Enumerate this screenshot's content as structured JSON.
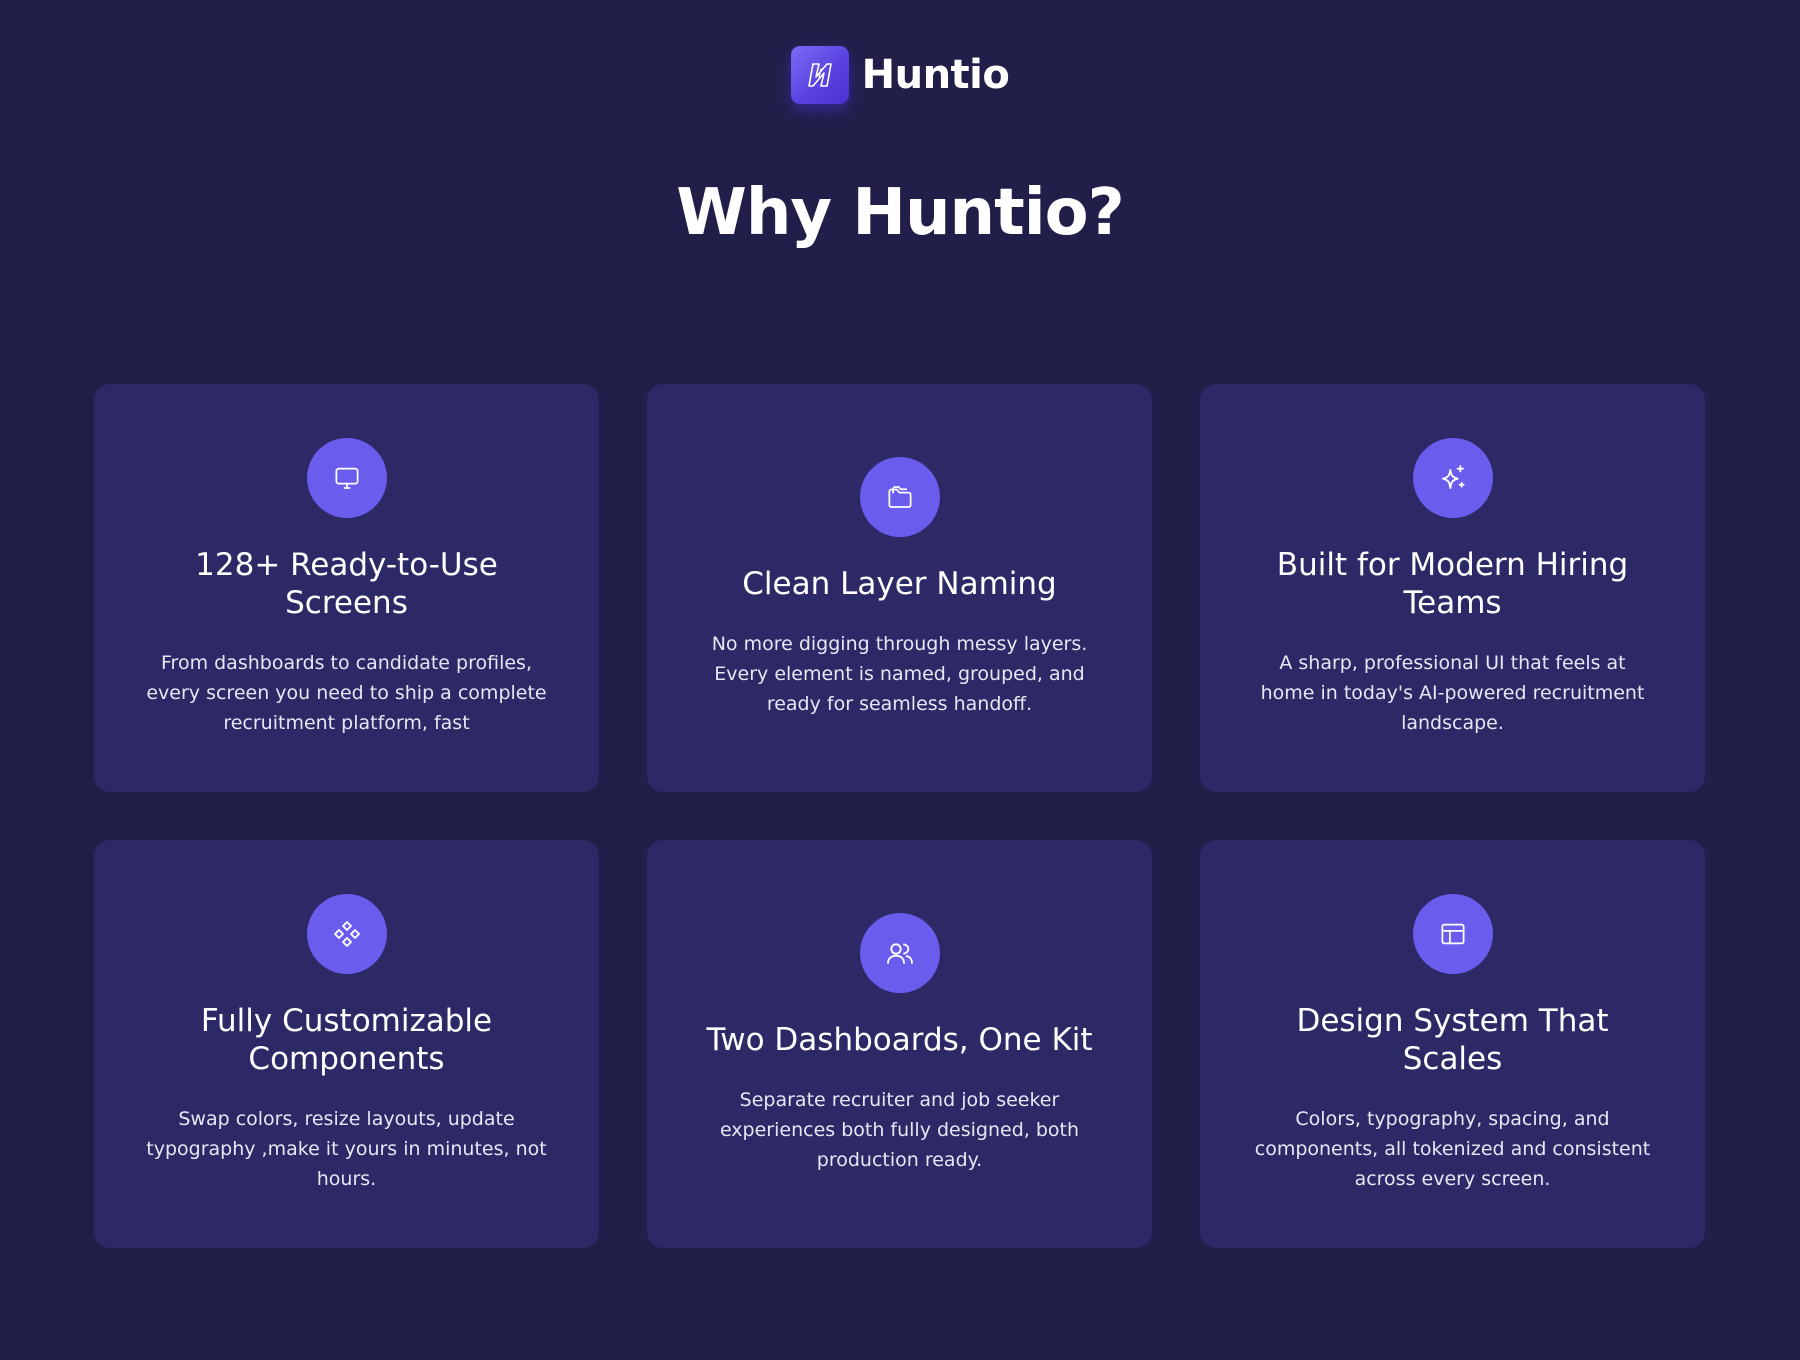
{
  "brand": {
    "name": "Huntio",
    "logo_icon": "lightning-bolt-icon"
  },
  "heading": "Why Huntio?",
  "colors": {
    "background": "#211f4a",
    "card": "#2c2966",
    "accent": "#6a5cec"
  },
  "features": [
    {
      "icon": "monitor-icon",
      "title": "128+ Ready-to-Use Screens",
      "description": "From dashboards to candidate profiles, every screen you need to ship a  complete recruitment platform, fast"
    },
    {
      "icon": "folder-icon",
      "title": "Clean Layer Naming",
      "description": "No more digging through messy layers.  Every element is named, grouped,  and ready for seamless handoff."
    },
    {
      "icon": "sparkles-icon",
      "title": "Built for Modern Hiring Teams",
      "description": "A sharp, professional UI that feels  at home in today's AI-powered  recruitment landscape."
    },
    {
      "icon": "components-icon",
      "title": "Fully Customizable Components",
      "description": "Swap colors, resize layouts, update typography ,make it yours in  minutes, not hours."
    },
    {
      "icon": "users-icon",
      "title": "Two Dashboards, One Kit",
      "description": "Separate recruiter and job seeker  experiences both fully designed,  both production ready."
    },
    {
      "icon": "layout-icon",
      "title": "Design System That Scales",
      "description": "Colors, typography, spacing, and components, all tokenized and  consistent across every screen."
    }
  ]
}
